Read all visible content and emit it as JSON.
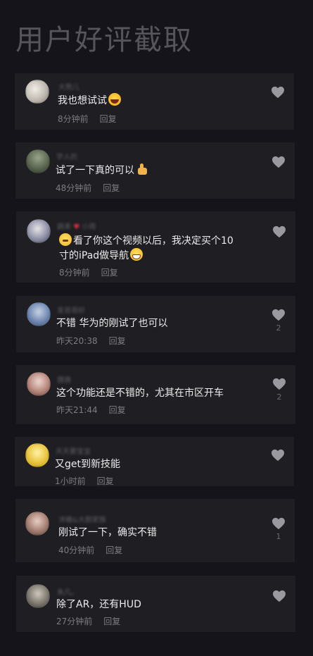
{
  "page_title": "用户好评截取",
  "colors": {
    "background": "#15141a",
    "card": "#1f1e22",
    "text_primary": "#ececee",
    "text_secondary": "#7d7c82",
    "like_icon": "#9a999f"
  },
  "comments": [
    {
      "username": "大熊儿",
      "text": "我也想试试",
      "emoji": "rolling-on-floor-laughing-emoji",
      "time": "8分钟前",
      "reply_label": "回复",
      "likes": ""
    },
    {
      "username": "学人的",
      "text": "试了一下真的可以",
      "emoji": "thumbs-up-emoji",
      "time": "48分钟前",
      "reply_label": "回复",
      "likes": ""
    },
    {
      "username": "跳来",
      "text_line1": "看了你这个视频以后，我决定买个10",
      "text_line2": "寸的iPad做导航",
      "emoji_lead": "thinking-face-emoji",
      "emoji": "grinning-face-emoji",
      "time": "8分钟前",
      "reply_label": "回复",
      "likes": ""
    },
    {
      "username": "发哥哥好",
      "text": "不错 华为的刚试了也可以",
      "time": "昨天20:38",
      "reply_label": "回复",
      "likes": "2"
    },
    {
      "username": "猜猜",
      "text": "这个功能还是不错的，尤其在市区开车",
      "time": "昨天21:44",
      "reply_label": "回复",
      "likes": "2"
    },
    {
      "username": "天天要宝宝",
      "text": "又get到新技能",
      "time": "1小时前",
      "reply_label": "回复",
      "likes": ""
    },
    {
      "username": "沐曦&大胆家族",
      "text": "刚试了一下，确实不错",
      "time": "40分钟前",
      "reply_label": "回复",
      "likes": "1"
    },
    {
      "username": "朱凡。",
      "text": "除了AR，还有HUD",
      "time": "27分钟前",
      "reply_label": "回复",
      "likes": ""
    }
  ]
}
